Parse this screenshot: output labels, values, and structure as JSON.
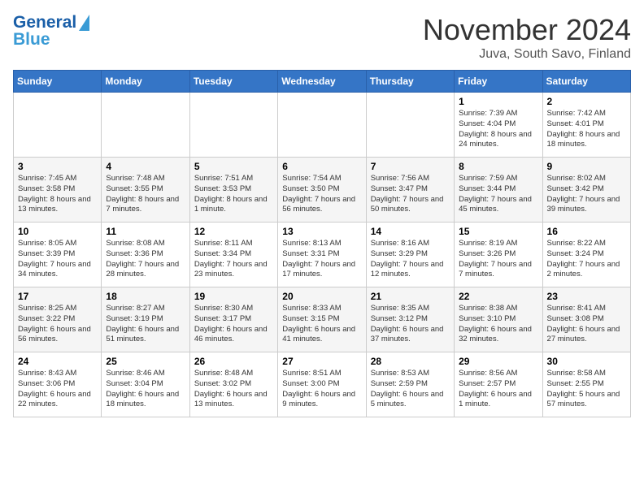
{
  "header": {
    "logo_general": "General",
    "logo_blue": "Blue",
    "month": "November 2024",
    "location": "Juva, South Savo, Finland"
  },
  "days_of_week": [
    "Sunday",
    "Monday",
    "Tuesday",
    "Wednesday",
    "Thursday",
    "Friday",
    "Saturday"
  ],
  "weeks": [
    [
      {
        "day": "",
        "info": ""
      },
      {
        "day": "",
        "info": ""
      },
      {
        "day": "",
        "info": ""
      },
      {
        "day": "",
        "info": ""
      },
      {
        "day": "",
        "info": ""
      },
      {
        "day": "1",
        "info": "Sunrise: 7:39 AM\nSunset: 4:04 PM\nDaylight: 8 hours and 24 minutes."
      },
      {
        "day": "2",
        "info": "Sunrise: 7:42 AM\nSunset: 4:01 PM\nDaylight: 8 hours and 18 minutes."
      }
    ],
    [
      {
        "day": "3",
        "info": "Sunrise: 7:45 AM\nSunset: 3:58 PM\nDaylight: 8 hours and 13 minutes."
      },
      {
        "day": "4",
        "info": "Sunrise: 7:48 AM\nSunset: 3:55 PM\nDaylight: 8 hours and 7 minutes."
      },
      {
        "day": "5",
        "info": "Sunrise: 7:51 AM\nSunset: 3:53 PM\nDaylight: 8 hours and 1 minute."
      },
      {
        "day": "6",
        "info": "Sunrise: 7:54 AM\nSunset: 3:50 PM\nDaylight: 7 hours and 56 minutes."
      },
      {
        "day": "7",
        "info": "Sunrise: 7:56 AM\nSunset: 3:47 PM\nDaylight: 7 hours and 50 minutes."
      },
      {
        "day": "8",
        "info": "Sunrise: 7:59 AM\nSunset: 3:44 PM\nDaylight: 7 hours and 45 minutes."
      },
      {
        "day": "9",
        "info": "Sunrise: 8:02 AM\nSunset: 3:42 PM\nDaylight: 7 hours and 39 minutes."
      }
    ],
    [
      {
        "day": "10",
        "info": "Sunrise: 8:05 AM\nSunset: 3:39 PM\nDaylight: 7 hours and 34 minutes."
      },
      {
        "day": "11",
        "info": "Sunrise: 8:08 AM\nSunset: 3:36 PM\nDaylight: 7 hours and 28 minutes."
      },
      {
        "day": "12",
        "info": "Sunrise: 8:11 AM\nSunset: 3:34 PM\nDaylight: 7 hours and 23 minutes."
      },
      {
        "day": "13",
        "info": "Sunrise: 8:13 AM\nSunset: 3:31 PM\nDaylight: 7 hours and 17 minutes."
      },
      {
        "day": "14",
        "info": "Sunrise: 8:16 AM\nSunset: 3:29 PM\nDaylight: 7 hours and 12 minutes."
      },
      {
        "day": "15",
        "info": "Sunrise: 8:19 AM\nSunset: 3:26 PM\nDaylight: 7 hours and 7 minutes."
      },
      {
        "day": "16",
        "info": "Sunrise: 8:22 AM\nSunset: 3:24 PM\nDaylight: 7 hours and 2 minutes."
      }
    ],
    [
      {
        "day": "17",
        "info": "Sunrise: 8:25 AM\nSunset: 3:22 PM\nDaylight: 6 hours and 56 minutes."
      },
      {
        "day": "18",
        "info": "Sunrise: 8:27 AM\nSunset: 3:19 PM\nDaylight: 6 hours and 51 minutes."
      },
      {
        "day": "19",
        "info": "Sunrise: 8:30 AM\nSunset: 3:17 PM\nDaylight: 6 hours and 46 minutes."
      },
      {
        "day": "20",
        "info": "Sunrise: 8:33 AM\nSunset: 3:15 PM\nDaylight: 6 hours and 41 minutes."
      },
      {
        "day": "21",
        "info": "Sunrise: 8:35 AM\nSunset: 3:12 PM\nDaylight: 6 hours and 37 minutes."
      },
      {
        "day": "22",
        "info": "Sunrise: 8:38 AM\nSunset: 3:10 PM\nDaylight: 6 hours and 32 minutes."
      },
      {
        "day": "23",
        "info": "Sunrise: 8:41 AM\nSunset: 3:08 PM\nDaylight: 6 hours and 27 minutes."
      }
    ],
    [
      {
        "day": "24",
        "info": "Sunrise: 8:43 AM\nSunset: 3:06 PM\nDaylight: 6 hours and 22 minutes."
      },
      {
        "day": "25",
        "info": "Sunrise: 8:46 AM\nSunset: 3:04 PM\nDaylight: 6 hours and 18 minutes."
      },
      {
        "day": "26",
        "info": "Sunrise: 8:48 AM\nSunset: 3:02 PM\nDaylight: 6 hours and 13 minutes."
      },
      {
        "day": "27",
        "info": "Sunrise: 8:51 AM\nSunset: 3:00 PM\nDaylight: 6 hours and 9 minutes."
      },
      {
        "day": "28",
        "info": "Sunrise: 8:53 AM\nSunset: 2:59 PM\nDaylight: 6 hours and 5 minutes."
      },
      {
        "day": "29",
        "info": "Sunrise: 8:56 AM\nSunset: 2:57 PM\nDaylight: 6 hours and 1 minute."
      },
      {
        "day": "30",
        "info": "Sunrise: 8:58 AM\nSunset: 2:55 PM\nDaylight: 5 hours and 57 minutes."
      }
    ]
  ]
}
